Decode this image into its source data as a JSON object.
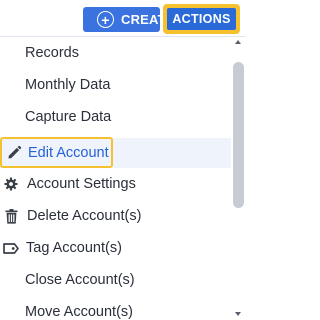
{
  "topbar": {
    "create_new_label": "CREATE NEW...",
    "actions_label": "ACTIONS",
    "plus_icon": "plus-circle-icon"
  },
  "menu": {
    "items": [
      {
        "label": "Records",
        "icon": null
      },
      {
        "label": "Monthly Data",
        "icon": null
      },
      {
        "label": "Capture Data",
        "icon": null
      },
      {
        "label": "Edit Account",
        "icon": "pencil-icon",
        "highlighted": true
      },
      {
        "label": "Account Settings",
        "icon": "gear-icon"
      },
      {
        "label": "Delete Account(s)",
        "icon": "trash-icon"
      },
      {
        "label": "Tag Account(s)",
        "icon": "tag-icon"
      },
      {
        "label": "Close Account(s)",
        "icon": null
      },
      {
        "label": "Move Account(s)",
        "icon": null
      }
    ]
  },
  "colors": {
    "primary_blue": "#3a73e0",
    "highlight_yellow": "#f6c12f",
    "active_text": "#2561d8",
    "text": "#2a2f3a"
  }
}
